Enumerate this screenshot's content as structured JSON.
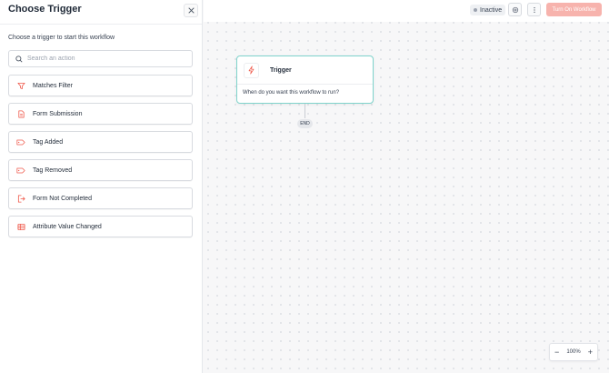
{
  "panel": {
    "title": "Choose Trigger",
    "subtitle": "Choose a trigger to start this workflow",
    "search_placeholder": "Search an action",
    "close_icon": "close-icon",
    "triggers": [
      {
        "label": "Matches Filter",
        "icon": "filter-icon"
      },
      {
        "label": "Form Submission",
        "icon": "document-icon"
      },
      {
        "label": "Tag Added",
        "icon": "tag-icon"
      },
      {
        "label": "Tag Removed",
        "icon": "tag-icon"
      },
      {
        "label": "Form Not Completed",
        "icon": "exit-icon"
      },
      {
        "label": "Attribute Value Changed",
        "icon": "table-icon"
      }
    ]
  },
  "topbar": {
    "status": "Inactive",
    "turn_on_label": "Turn On Workflow"
  },
  "canvas": {
    "node": {
      "title": "Trigger",
      "description": "When do you want this workflow to run?",
      "icon": "bolt-icon"
    },
    "end_label": "END",
    "zoom": "100%"
  },
  "colors": {
    "accent": "#ef5a4c",
    "node_border": "#7fd3cc",
    "turn_on_bg": "#f7b3ad"
  }
}
